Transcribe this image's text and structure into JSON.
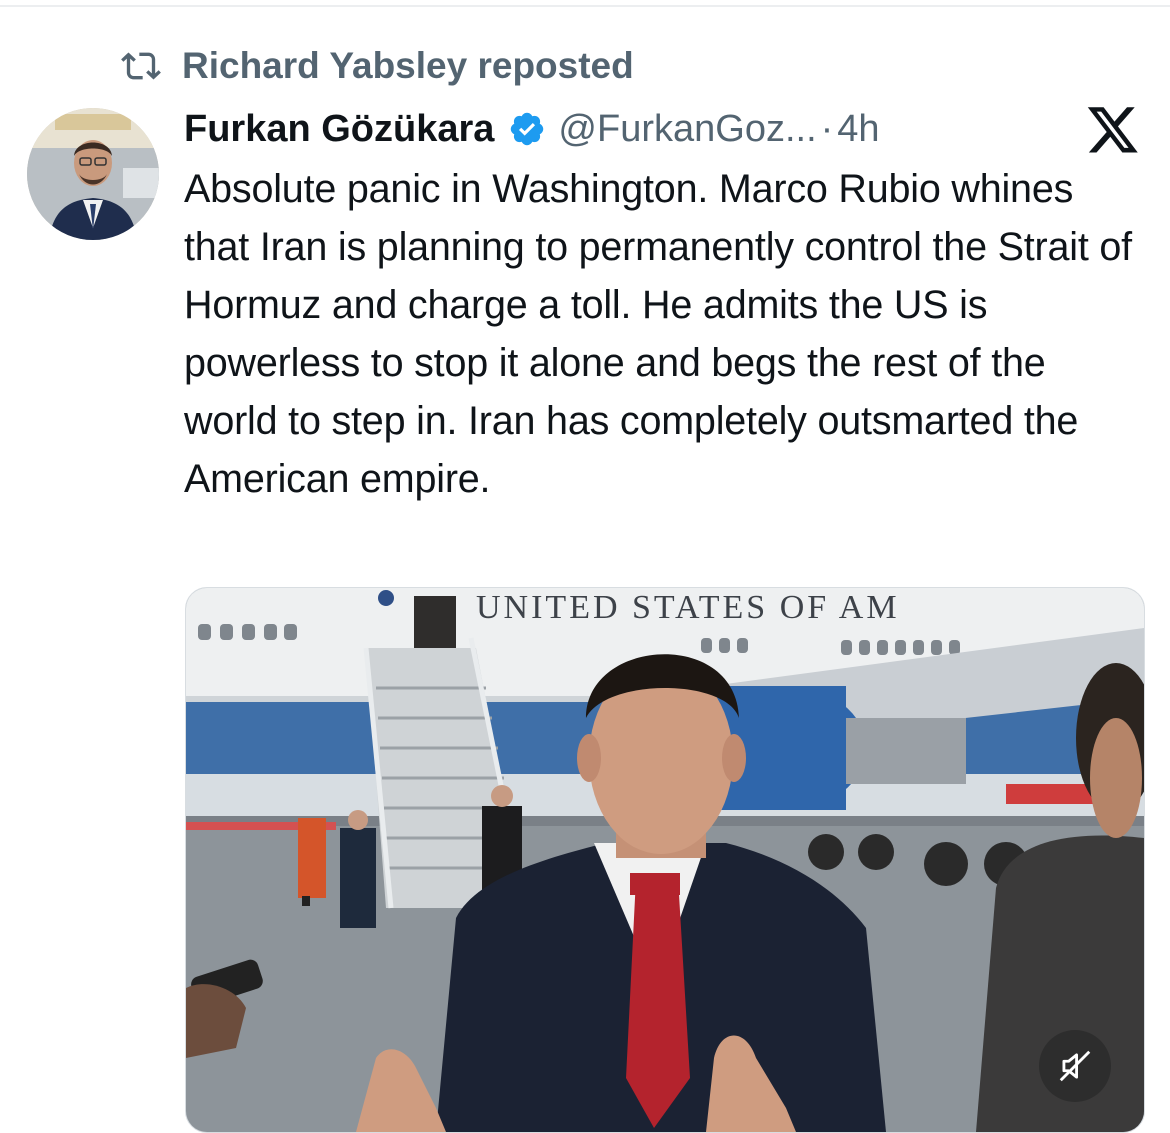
{
  "repost": {
    "label": "Richard Yabsley reposted",
    "icon": "repost-icon"
  },
  "tweet": {
    "display_name": "Furkan Gözükara",
    "verified": true,
    "handle": "@FurkanGoz...",
    "separator": "·",
    "time": "4h",
    "text": "Absolute panic in Washington. Marco Rubio whines that Iran is planning to permanently control the Strait of Hormuz and charge a toll. He admits the US is powerless to stop it alone and begs the rest of the world to step in. Iran has completely outsmarted the American empire."
  },
  "media": {
    "plane_text": "UNITED STATES OF AM",
    "mute_icon": "muted-speaker-icon"
  },
  "colors": {
    "secondary_text": "#536471",
    "primary_text": "#0f1419",
    "verified_blue": "#1d9bf0"
  },
  "brand": {
    "logo": "x-logo-icon"
  }
}
